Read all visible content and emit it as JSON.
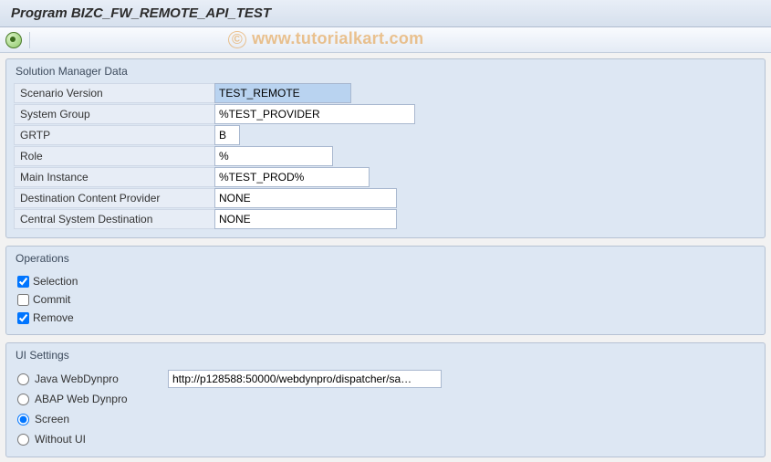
{
  "header": {
    "title": "Program BIZC_FW_REMOTE_API_TEST"
  },
  "watermark": "www.tutorialkart.com",
  "groups": {
    "solman": {
      "title": "Solution Manager Data",
      "scenario_version": {
        "label": "Scenario Version",
        "value": "TEST_REMOTE"
      },
      "system_group": {
        "label": "System Group",
        "value": "%TEST_PROVIDER"
      },
      "grtp": {
        "label": "GRTP",
        "value": "B"
      },
      "role": {
        "label": "Role",
        "value": "%"
      },
      "main_instance": {
        "label": "Main Instance",
        "value": "%TEST_PROD%"
      },
      "dest_cp": {
        "label": "Destination Content Provider",
        "value": "NONE"
      },
      "central_dest": {
        "label": "Central System Destination",
        "value": "NONE"
      }
    },
    "ops": {
      "title": "Operations",
      "selection": {
        "label": "Selection",
        "checked": true
      },
      "commit": {
        "label": "Commit",
        "checked": false
      },
      "remove": {
        "label": "Remove",
        "checked": true
      }
    },
    "ui": {
      "title": "UI Settings",
      "java_wd": {
        "label": "Java WebDynpro",
        "value": "http://p128588:50000/webdynpro/dispatcher/sa…"
      },
      "abap_wd": {
        "label": "ABAP Web Dynpro"
      },
      "screen": {
        "label": "Screen"
      },
      "without": {
        "label": "Without UI"
      },
      "selected": "screen"
    }
  }
}
